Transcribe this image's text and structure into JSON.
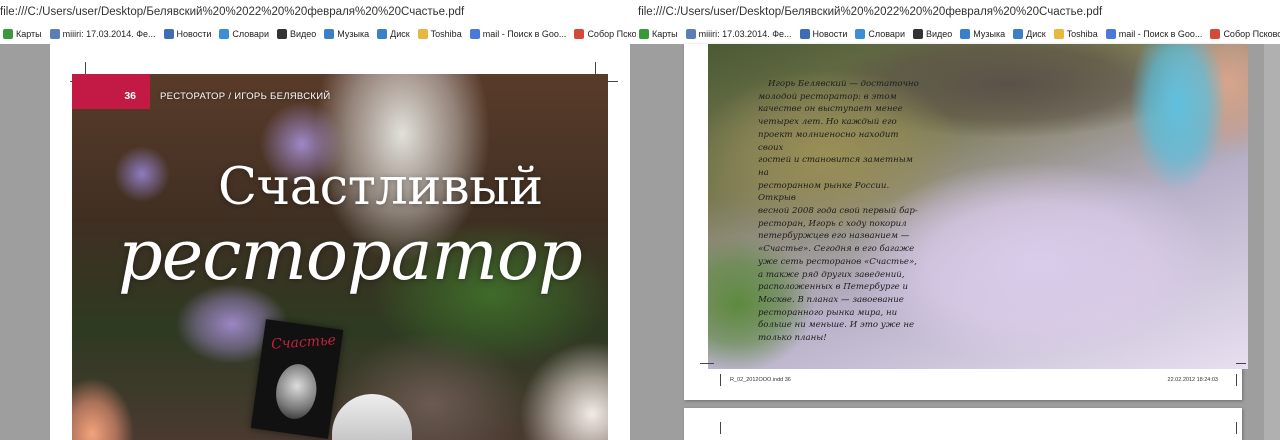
{
  "left_window": {
    "url": "file:///C:/Users/user/Desktop/Белявский%20%2022%20%20февраля%20%20Счастье.pdf",
    "bookmarks": [
      {
        "label": "Карты",
        "icon": "maps-icon",
        "color": "#3a9a3a"
      },
      {
        "label": "miiiri: 17.03.2014. Фе...",
        "icon": "user-icon",
        "color": "#5b7fb5"
      },
      {
        "label": "Новости",
        "icon": "news-icon",
        "color": "#3d6db5"
      },
      {
        "label": "Словари",
        "icon": "dictionary-icon",
        "color": "#3d8fd5"
      },
      {
        "label": "Видео",
        "icon": "video-icon",
        "color": "#333333"
      },
      {
        "label": "Музыка",
        "icon": "music-icon",
        "color": "#3a80c9"
      },
      {
        "label": "Диск",
        "icon": "disk-icon",
        "color": "#3a80c9"
      },
      {
        "label": "Toshiba",
        "icon": "folder-icon",
        "color": "#e6b840"
      },
      {
        "label": "mail - Поиск в Goo...",
        "icon": "google-icon",
        "color": "#4a7ad8"
      },
      {
        "label": "Собор Псково-Печ...",
        "icon": "site-icon",
        "color": "#d24b3a"
      }
    ],
    "page": {
      "page_number": "36",
      "kicker": "РЕСТОРАТОР / ИГОРЬ БЕЛЯВСКИЙ",
      "title_line1": "Счастливый",
      "title_line2": "ресторатор",
      "book_title": "Счастье"
    }
  },
  "right_window": {
    "url": "file:///C:/Users/user/Desktop/Белявский%20%2022%20%20февраля%20%20Счастье.pdf",
    "bookmarks": [
      {
        "label": "Карты",
        "icon": "maps-icon",
        "color": "#3a9a3a"
      },
      {
        "label": "miiiri: 17.03.2014. Фе...",
        "icon": "user-icon",
        "color": "#5b7fb5"
      },
      {
        "label": "Новости",
        "icon": "news-icon",
        "color": "#3d6db5"
      },
      {
        "label": "Словари",
        "icon": "dictionary-icon",
        "color": "#3d8fd5"
      },
      {
        "label": "Видео",
        "icon": "video-icon",
        "color": "#333333"
      },
      {
        "label": "Музыка",
        "icon": "music-icon",
        "color": "#3a80c9"
      },
      {
        "label": "Диск",
        "icon": "disk-icon",
        "color": "#3a80c9"
      },
      {
        "label": "Toshiba",
        "icon": "folder-icon",
        "color": "#e6b840"
      },
      {
        "label": "mail - Поиск в Goo...",
        "icon": "google-icon",
        "color": "#4a7ad8"
      },
      {
        "label": "Собор Псково-Печ...",
        "icon": "site-icon",
        "color": "#d24b3a"
      }
    ],
    "page": {
      "paragraph": "Игорь Белявский — достаточно\nмолодой ресторатор: в этом\nкачестве он выступает менее\nчетырех лет. Но каждый его\nпроект молниеносно находит своих\nгостей и становится заметным на\nресторанном рынке России. Открыв\nвесной 2008 года свой первый бар-\nресторан, Игорь с ходу покорил\nпетербуржцев его названием —\n«Счастье». Сегодня в его багаже\nуже сеть ресторанов «Счастье»,\nа также ряд других заведений,\nрасположенных в Петербурге и\nМоскве. В планах — завоевание\nресторанного рынка мира, ни\nбольше ни меньше. И это уже не\nтолько планы!",
      "footer_left": "R_02_2012ООО.indd   36",
      "footer_right": "22.02.2012    18:24:03"
    }
  }
}
